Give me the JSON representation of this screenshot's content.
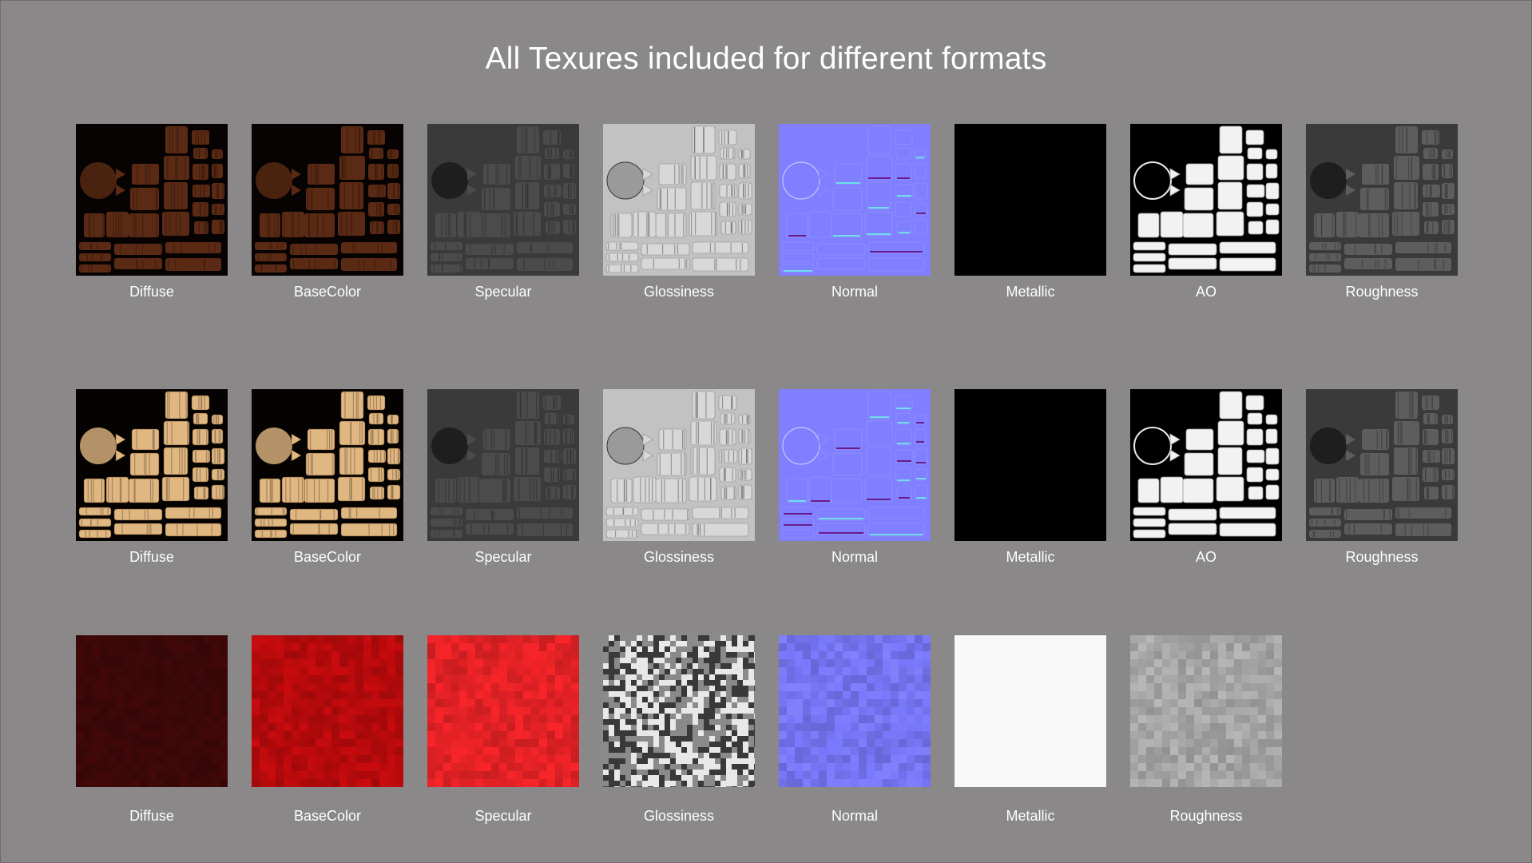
{
  "title": "All Texures included for different formats",
  "rows": [
    {
      "tiles": [
        {
          "label": "Diffuse",
          "style": "uv-dark-wood",
          "color": "#5b2a14"
        },
        {
          "label": "BaseColor",
          "style": "uv-dark-wood",
          "color": "#5b2a14"
        },
        {
          "label": "Specular",
          "style": "uv-gray",
          "color": "#3c3c3c"
        },
        {
          "label": "Glossiness",
          "style": "uv-light",
          "color": "#bdbdbd"
        },
        {
          "label": "Normal",
          "style": "uv-normal",
          "color": "#7f7fff"
        },
        {
          "label": "Metallic",
          "style": "solid",
          "color": "#000000"
        },
        {
          "label": "AO",
          "style": "uv-ao",
          "color": "#ffffff"
        },
        {
          "label": "Roughness",
          "style": "uv-gray",
          "color": "#4a4a4a"
        }
      ]
    },
    {
      "tiles": [
        {
          "label": "Diffuse",
          "style": "uv-light-wood",
          "color": "#e0b681"
        },
        {
          "label": "BaseColor",
          "style": "uv-light-wood",
          "color": "#e0b681"
        },
        {
          "label": "Specular",
          "style": "uv-gray",
          "color": "#3c3c3c"
        },
        {
          "label": "Glossiness",
          "style": "uv-light",
          "color": "#bdbdbd"
        },
        {
          "label": "Normal",
          "style": "uv-normal",
          "color": "#7f7fff"
        },
        {
          "label": "Metallic",
          "style": "solid",
          "color": "#000000"
        },
        {
          "label": "AO",
          "style": "uv-ao",
          "color": "#ffffff"
        },
        {
          "label": "Roughness",
          "style": "uv-gray",
          "color": "#4a4a4a"
        }
      ]
    },
    {
      "tiles": [
        {
          "label": "Diffuse",
          "style": "noise",
          "color": "#3d0808"
        },
        {
          "label": "BaseColor",
          "style": "noise",
          "color": "#b80a0d"
        },
        {
          "label": "Specular",
          "style": "noise",
          "color": "#e52226"
        },
        {
          "label": "Glossiness",
          "style": "noise-contrast",
          "color": "#8a8a8a"
        },
        {
          "label": "Normal",
          "style": "noise",
          "color": "#7676f6"
        },
        {
          "label": "Metallic",
          "style": "solid",
          "color": "#f8f8f8"
        },
        {
          "label": "Roughness",
          "style": "noise",
          "color": "#a7a7a7"
        }
      ]
    }
  ]
}
